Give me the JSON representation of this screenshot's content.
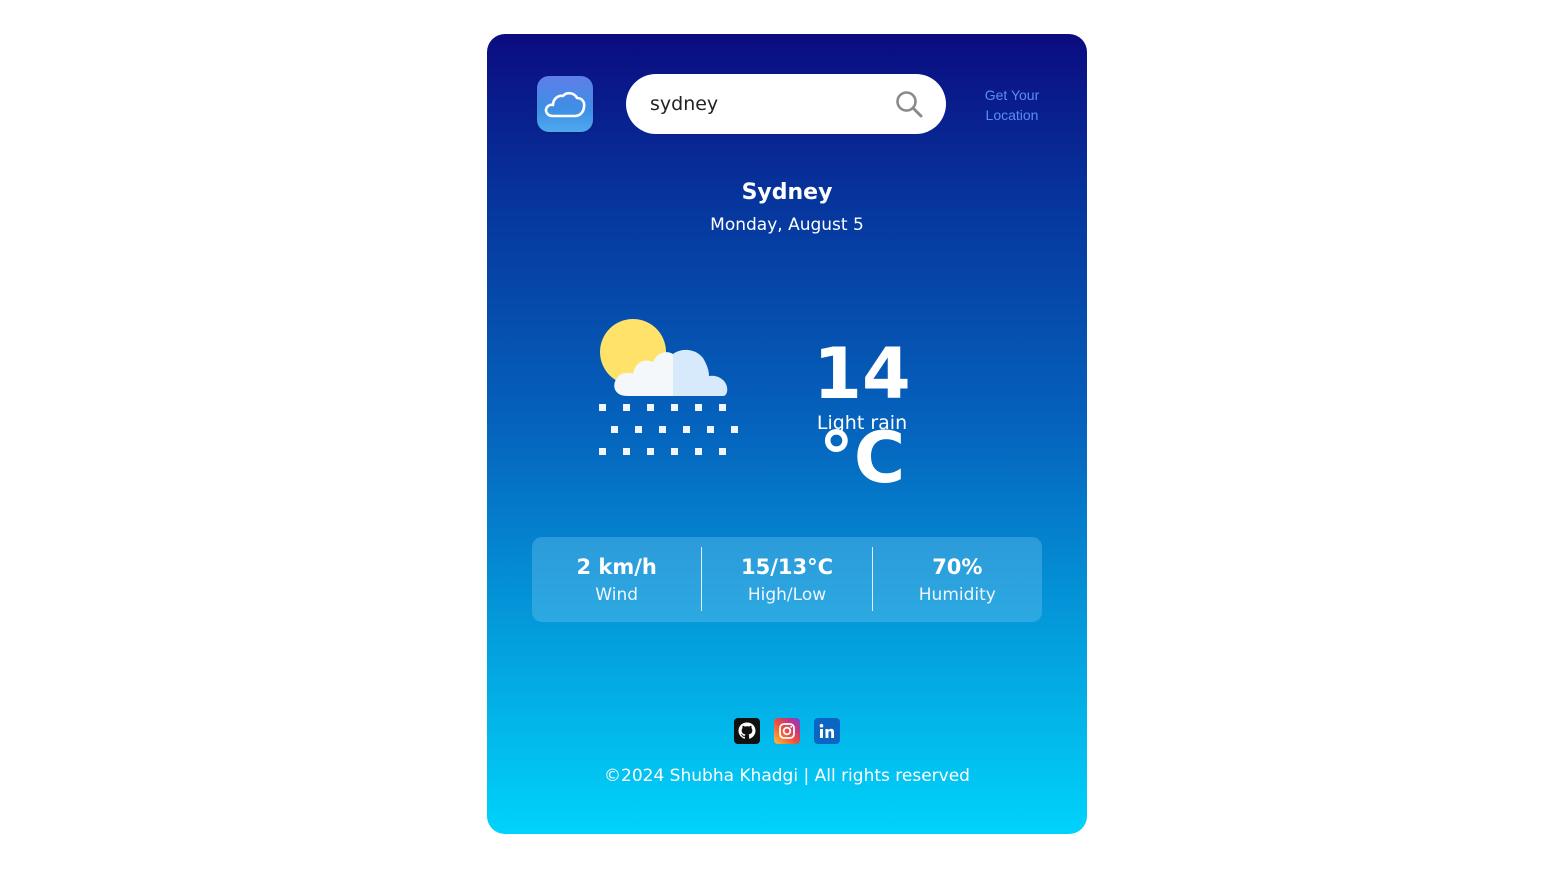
{
  "header": {
    "search": {
      "value": "sydney"
    },
    "location_link": "Get Your Location"
  },
  "weather": {
    "city": "Sydney",
    "date": "Monday, August 5",
    "temperature": "14 °C",
    "condition": "Light rain",
    "icon": "sun-cloud-rain-icon"
  },
  "stats": [
    {
      "value": "2 km/h",
      "label": "Wind"
    },
    {
      "value": "15/13°C",
      "label": "High/Low"
    },
    {
      "value": "70%",
      "label": "Humidity"
    }
  ],
  "footer": {
    "socials": [
      "github-icon",
      "instagram-icon",
      "linkedin-icon"
    ],
    "copyright": "©2024 Shubha Khadgi | All rights reserved"
  },
  "colors": {
    "gradient_top": "#0b0c80",
    "gradient_bottom": "#00d3fb",
    "link": "#5b8ef5"
  }
}
